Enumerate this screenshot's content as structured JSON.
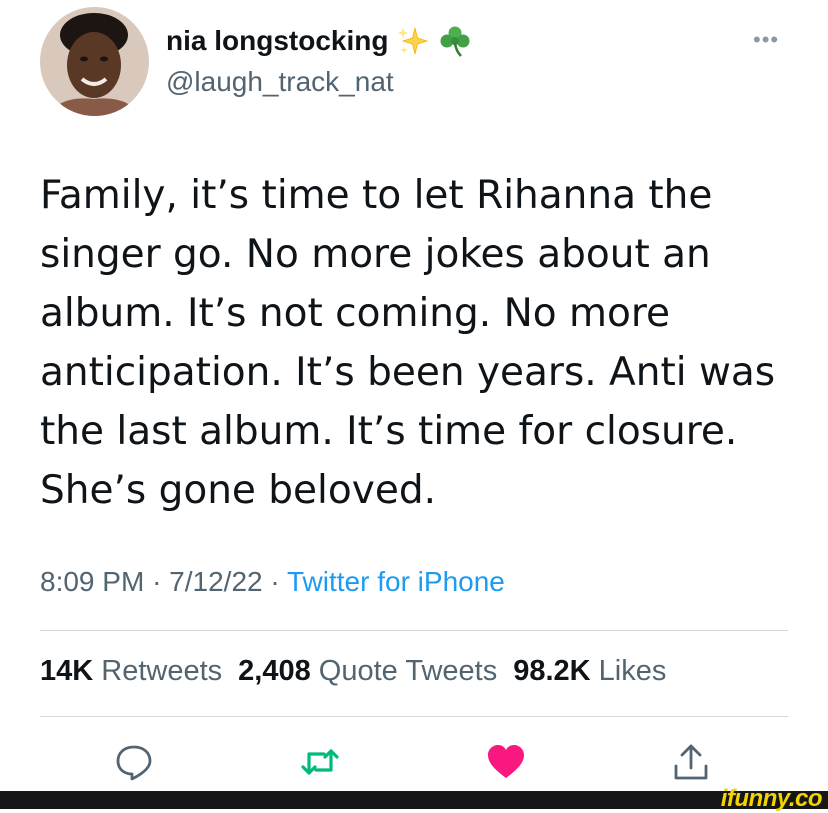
{
  "author": {
    "display_name": "nia longstocking",
    "handle": "@laugh_track_nat",
    "name_emojis": [
      "sparkles-icon",
      "shamrock-icon"
    ]
  },
  "tweet": {
    "text": "Family, it’s time to let Rihanna the\nsinger go. No more jokes about an\nalbum. It’s not coming. No more\nanticipation. It’s been years. Anti was\nthe last album. It’s time for closure.\nShe’s gone beloved.",
    "time": "8:09 PM",
    "date": "7/12/22",
    "separator": "·",
    "source": "Twitter for iPhone"
  },
  "stats": {
    "retweets_count": "14K",
    "retweets_label": "Retweets",
    "quotes_count": "2,408",
    "quotes_label": "Quote Tweets",
    "likes_count": "98.2K",
    "likes_label": "Likes"
  },
  "actions": [
    "reply-icon",
    "retweet-icon",
    "like-icon",
    "share-icon"
  ],
  "colors": {
    "text": "#0f1419",
    "secondary": "#536471",
    "link": "#1d9bf0",
    "retweet": "#00ba7c",
    "like": "#f91880",
    "divider": "#cfd9de"
  },
  "watermark": "ifunny.co"
}
